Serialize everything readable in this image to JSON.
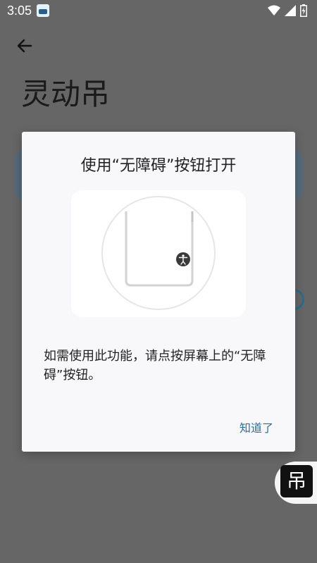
{
  "status_bar": {
    "time": "3:05",
    "icons": [
      "app-notification-icon",
      "wifi-icon",
      "signal-icon",
      "battery-charging-icon"
    ]
  },
  "header": {
    "back_icon": "arrow-left-icon",
    "title": "灵动吊"
  },
  "dialog": {
    "title": "使用“无障碍”按钮打开",
    "illustration_icon": "accessibility-icon",
    "message": "如需使用此功能，请点按屏幕上的“无障碍”按钮。",
    "ok_label": "知道了"
  },
  "floating_widget": {
    "label": "吊"
  },
  "colors": {
    "scrim": "#666666",
    "dialog_bg": "#f8f8fa",
    "accent": "#2c6f93"
  }
}
